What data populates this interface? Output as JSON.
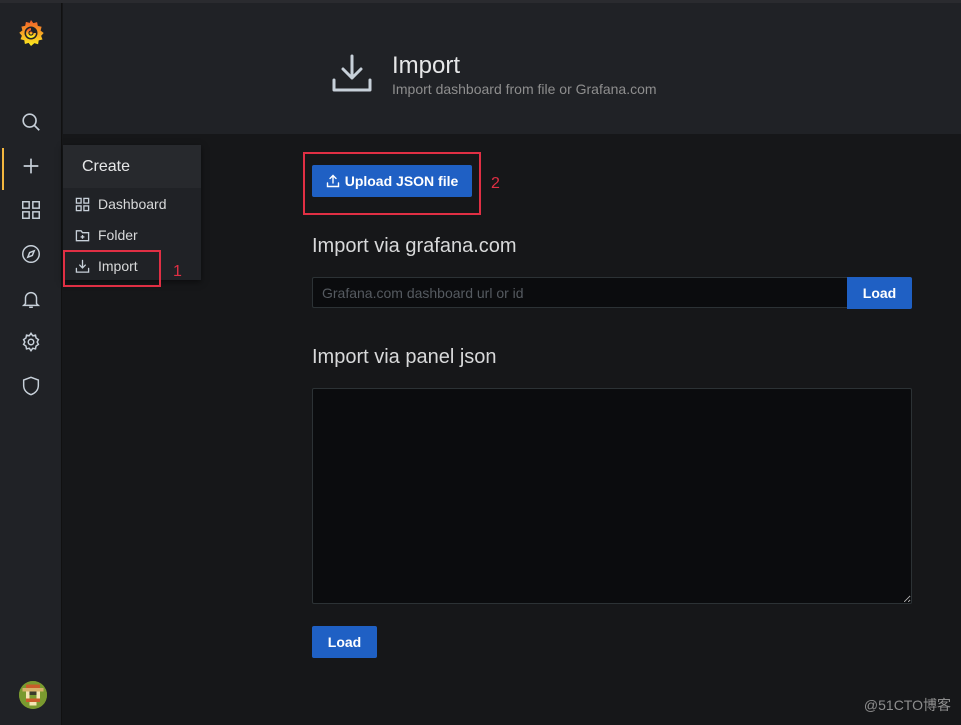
{
  "header": {
    "title": "Import",
    "subtitle": "Import dashboard from file or Grafana.com"
  },
  "sidebar": {
    "icons": [
      "grafana-logo",
      "search-icon",
      "plus-icon",
      "dashboards-icon",
      "explore-icon",
      "alerting-icon",
      "configuration-icon",
      "shield-icon"
    ]
  },
  "create_menu": {
    "heading": "Create",
    "items": [
      {
        "label": "Dashboard",
        "icon": "apps-icon"
      },
      {
        "label": "Folder",
        "icon": "folder-plus-icon"
      },
      {
        "label": "Import",
        "icon": "import-icon"
      }
    ]
  },
  "annotations": {
    "step1": "1",
    "step2": "2",
    "color": "#e02f44"
  },
  "main": {
    "upload_button": "Upload JSON file",
    "grafana_section_title": "Import via grafana.com",
    "grafana_input_placeholder": "Grafana.com dashboard url or id",
    "grafana_input_value": "",
    "grafana_load_button": "Load",
    "panel_section_title": "Import via panel json",
    "panel_json_value": "",
    "panel_load_button": "Load"
  },
  "colors": {
    "primary_button": "#1f60c4",
    "background": "#161719",
    "panel": "#202226"
  },
  "watermark": "@51CTO博客"
}
